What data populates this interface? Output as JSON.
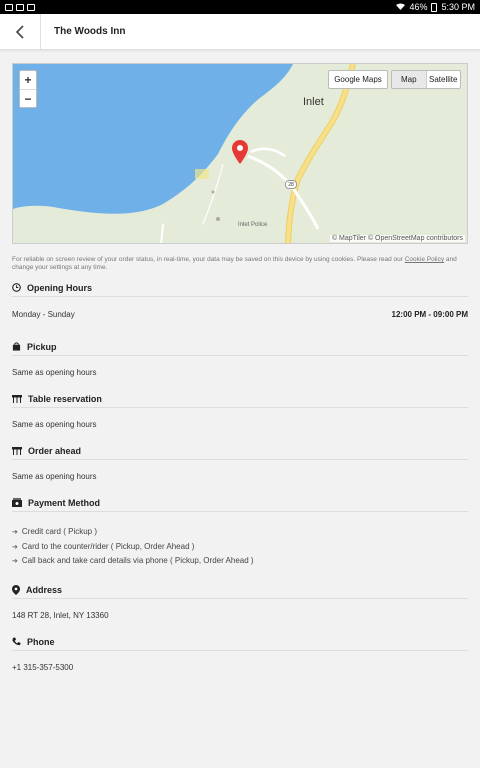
{
  "status_bar": {
    "battery": "46%",
    "time": "5:30 PM"
  },
  "header": {
    "title": "The Woods Inn"
  },
  "map": {
    "google_maps_label": "Google Maps",
    "map_label": "Map",
    "satellite_label": "Satellite",
    "zoom_in": "+",
    "zoom_out": "−",
    "town": "Inlet",
    "place": "Inlet Police",
    "route": "28",
    "attribution": "© MapTiler © OpenStreetMap contributors"
  },
  "cookie_notice": {
    "text": "For reliable on screen review of your order status, in real-time, your data may be saved on this device by using cookies. Please read our ",
    "link": "Cookie Policy",
    "suffix": " and change your settings at any time."
  },
  "opening_hours": {
    "heading": "Opening Hours",
    "days": "Monday - Sunday",
    "hours": "12:00 PM - 09:00 PM"
  },
  "pickup": {
    "heading": "Pickup",
    "text": "Same as opening hours"
  },
  "table_reservation": {
    "heading": "Table reservation",
    "text": "Same as opening hours"
  },
  "order_ahead": {
    "heading": "Order ahead",
    "text": "Same as opening hours"
  },
  "payment": {
    "heading": "Payment Method",
    "methods": [
      "Credit card ( Pickup )",
      "Card to the counter/rider ( Pickup, Order Ahead )",
      "Call back and take card details via phone ( Pickup, Order Ahead )"
    ]
  },
  "address": {
    "heading": "Address",
    "text": "148 RT 28, Inlet, NY 13360"
  },
  "phone": {
    "heading": "Phone",
    "text": "+1 315-357-5300"
  },
  "colors": {
    "accent": "#222222",
    "marker": "#e53935",
    "water": "#6fb0e8",
    "land": "#e4ecd9",
    "road": "#f5d76e"
  }
}
